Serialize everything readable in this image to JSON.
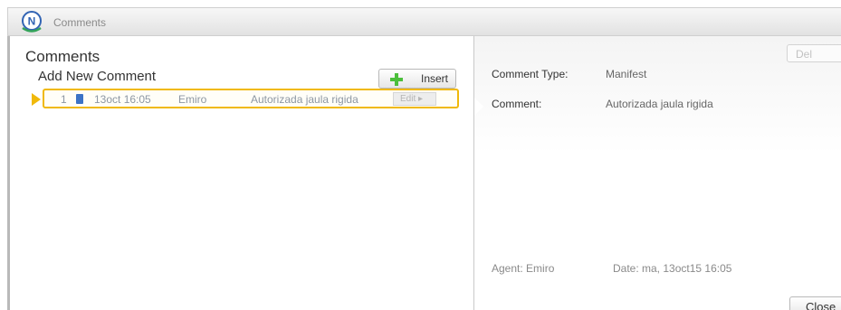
{
  "window": {
    "title": "Comments",
    "logo_letter": "N"
  },
  "left_panel": {
    "title": "Comments",
    "add_new_label": "Add New Comment",
    "insert_label": "Insert",
    "comments": [
      {
        "number": "1",
        "date": "13oct 16:05",
        "agent": "Emiro",
        "text": "Autorizada jaula rigida",
        "edit_label": "Edit ▸"
      }
    ]
  },
  "detail": {
    "delete_label": "Del",
    "comment_type_label": "Comment Type:",
    "comment_type_value": "Manifest",
    "comment_label": "Comment:",
    "comment_value": "Autorizada jaula rigida",
    "agent_text": "Agent: Emiro",
    "date_text": "Date: ma, 13oct15 16:05",
    "close_label": "Close"
  },
  "colors": {
    "selection_accent": "#f0b90a",
    "plus_green": "#4cbf3c",
    "doc_blue": "#3c73c6"
  },
  "icons": {
    "logo": "n-logo-icon",
    "insert": "plus-icon",
    "row": "document-icon",
    "selection": "selection-arrow-icon"
  }
}
